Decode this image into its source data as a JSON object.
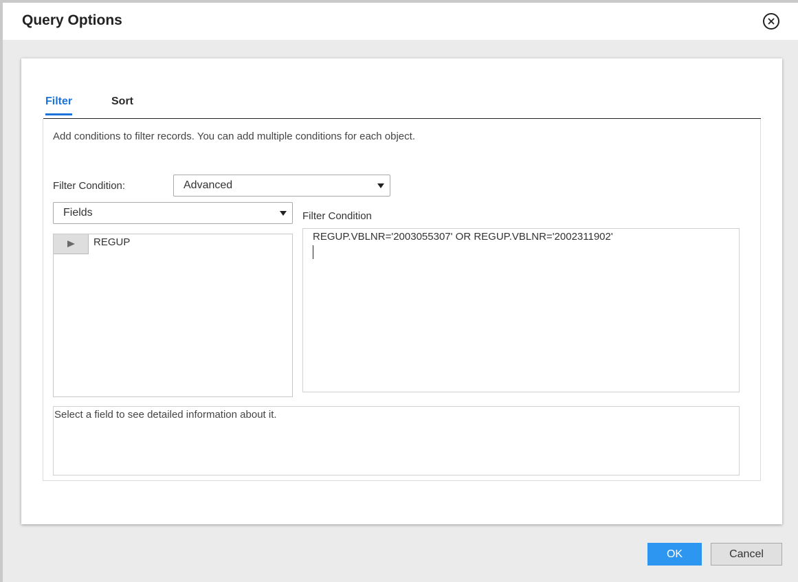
{
  "dialog": {
    "title": "Query Options",
    "close_icon": "close-circle-icon"
  },
  "tabs": [
    {
      "label": "Filter",
      "active": true
    },
    {
      "label": "Sort",
      "active": false
    }
  ],
  "filter": {
    "description": "Add conditions to filter records. You can add multiple conditions for each object.",
    "condition_label": "Filter Condition:",
    "condition_select": "Advanced",
    "fields_select": "Fields",
    "fields_list": [
      {
        "label": "REGUP",
        "icon": "expand-arrow-icon"
      }
    ],
    "editor_label": "Filter Condition",
    "editor_value": "REGUP.VBLNR='2003055307' OR REGUP.VBLNR='2002311902'",
    "info_text": "Select a field to see detailed information about it."
  },
  "footer": {
    "ok_label": "OK",
    "cancel_label": "Cancel"
  },
  "colors": {
    "accent": "#1a73d9",
    "ok_button": "#2d96f0"
  }
}
